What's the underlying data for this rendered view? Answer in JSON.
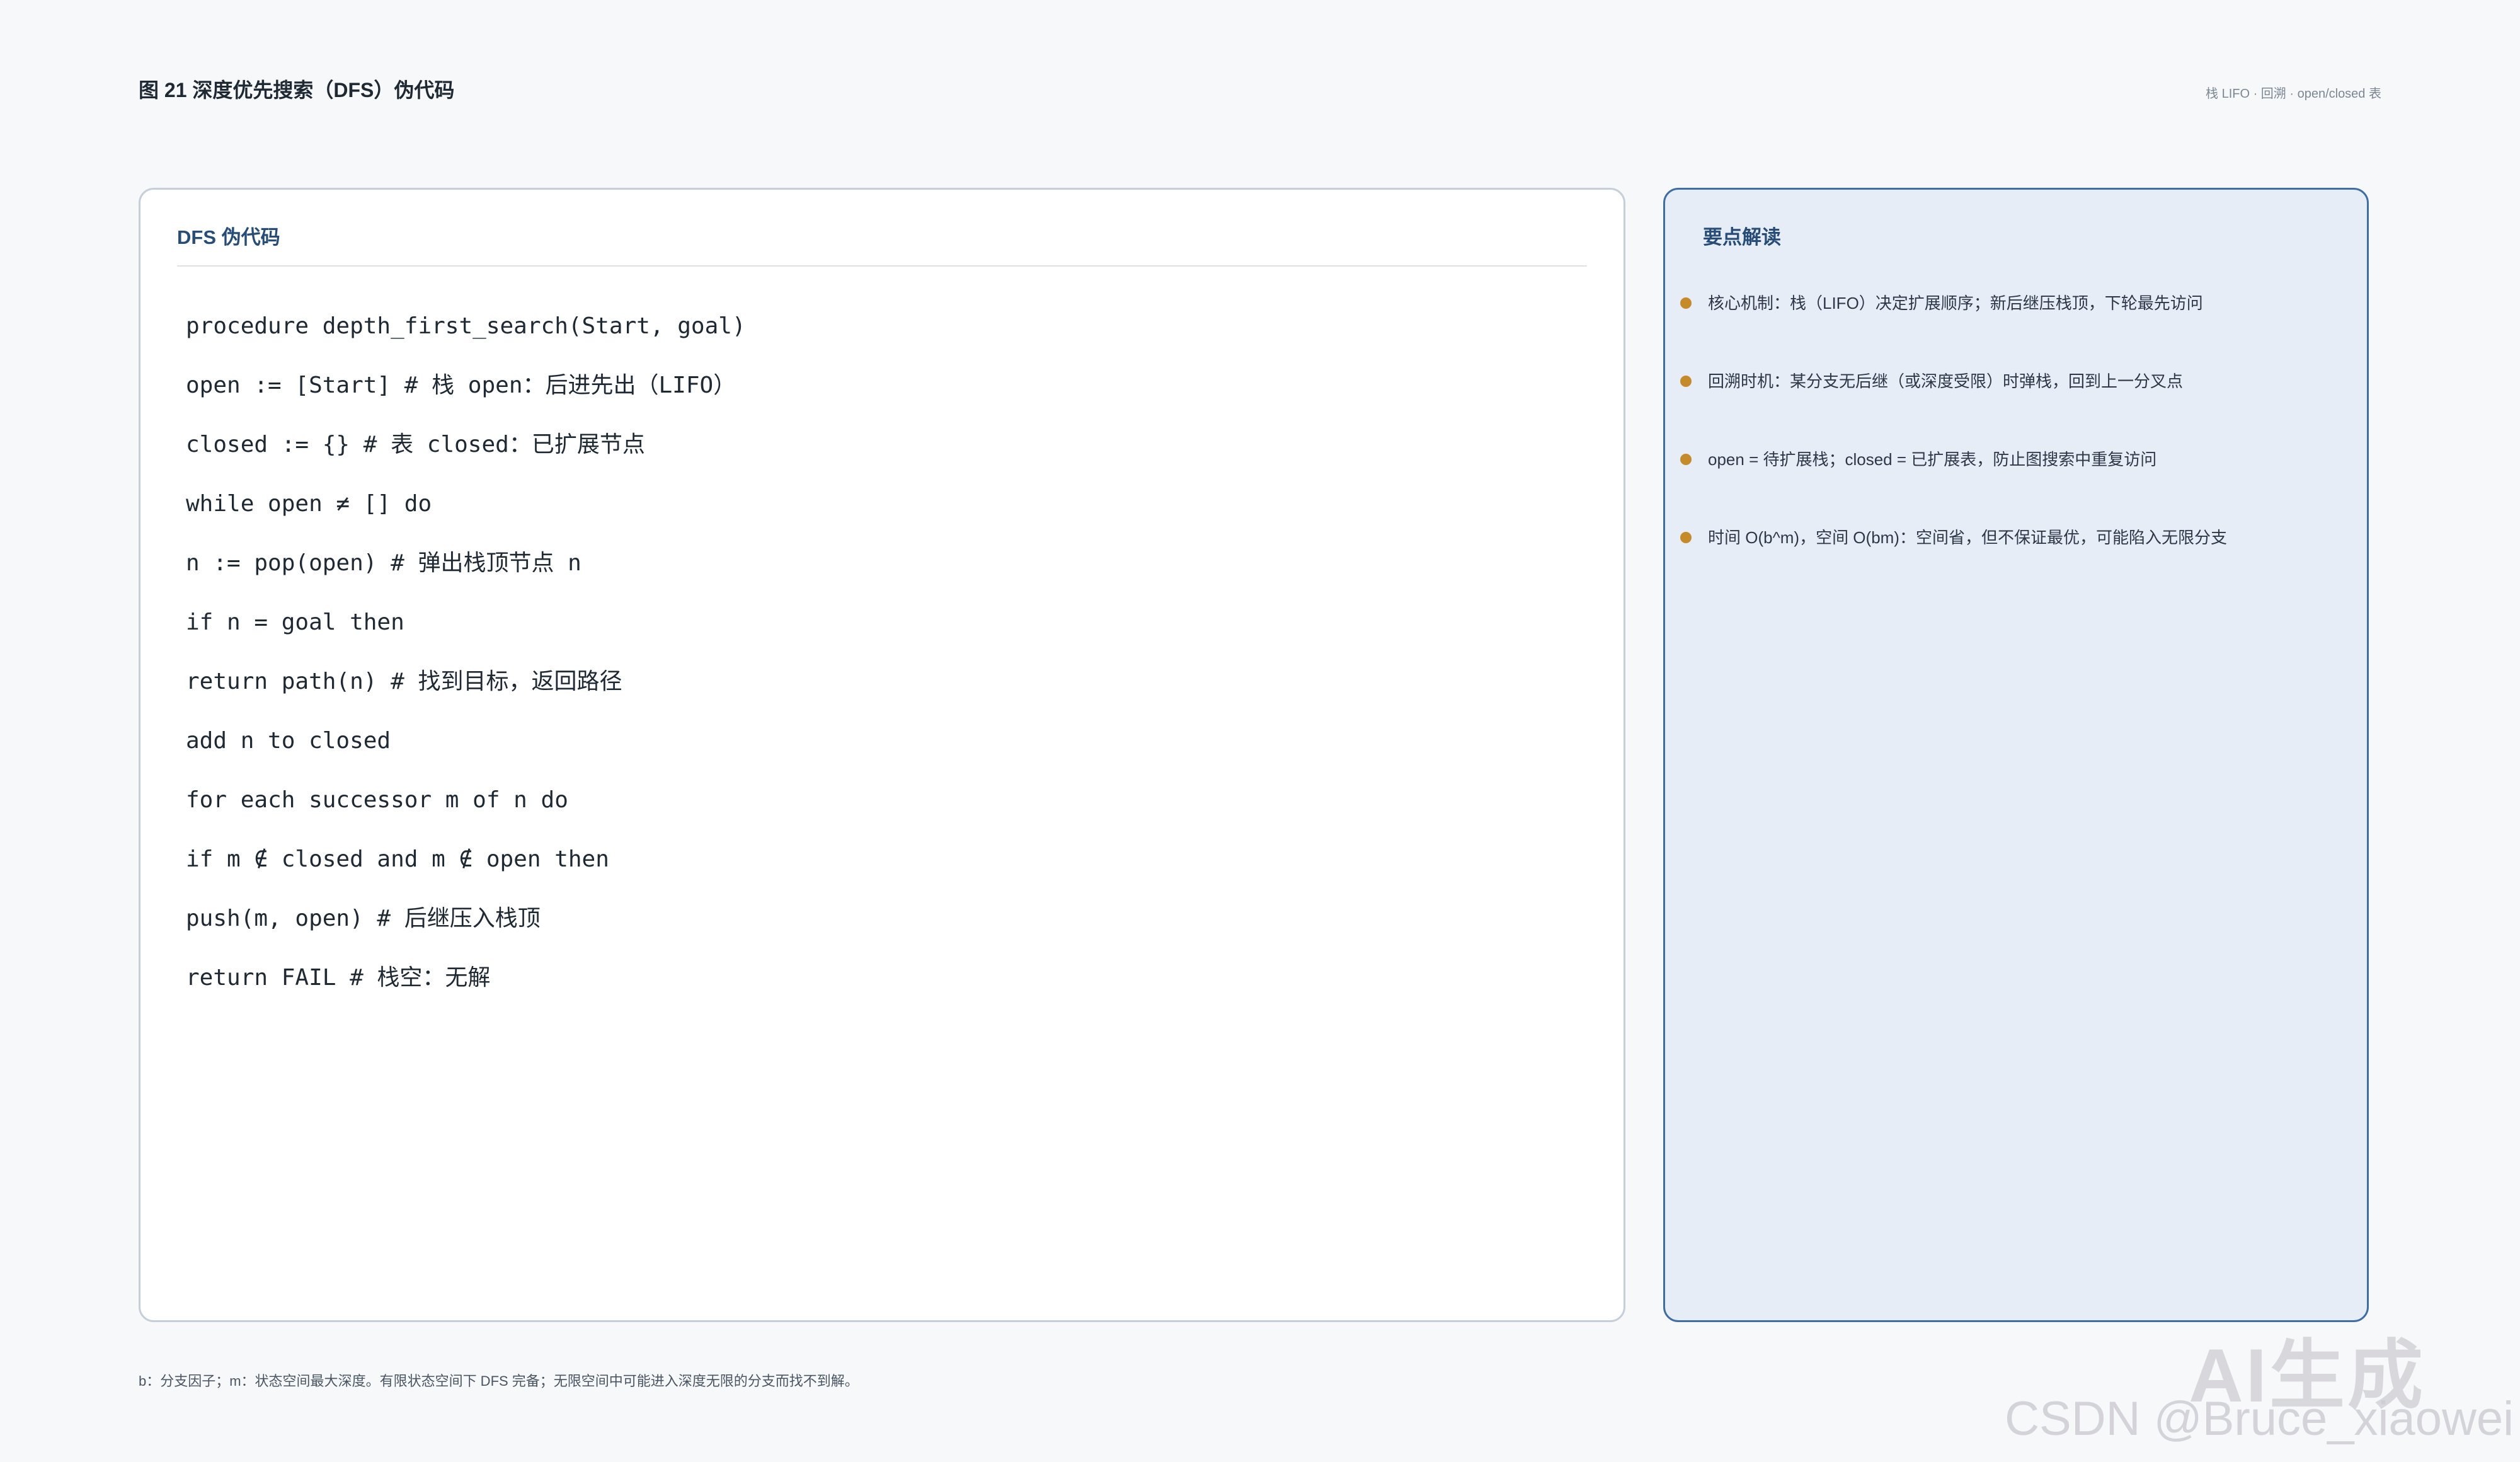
{
  "figure": {
    "title": "图 21 深度优先搜索（DFS）伪代码",
    "tags": "栈 LIFO · 回溯 · open/closed 表"
  },
  "code_panel": {
    "title": "DFS 伪代码",
    "lines": [
      "procedure depth_first_search(Start, goal)",
      "open := [Start] # 栈 open：后进先出（LIFO）",
      "closed := {} # 表 closed：已扩展节点",
      "while open ≠ [] do",
      "n := pop(open) # 弹出栈顶节点 n",
      "if n = goal then",
      "return path(n) # 找到目标，返回路径",
      "add n to closed",
      "for each successor m of n do",
      "if m ∉ closed and m ∉ open then",
      "push(m, open) # 后继压入栈顶",
      "return FAIL # 栈空：无解"
    ]
  },
  "notes_panel": {
    "title": "要点解读",
    "bullet_color": "#c58b2b",
    "items": [
      "核心机制：栈（LIFO）决定扩展顺序；新后继压栈顶，下轮最先访问",
      "回溯时机：某分支无后继（或深度受限）时弹栈，回到上一分叉点",
      "open = 待扩展栈；closed = 已扩展表，防止图搜索中重复访问",
      "时间 O(b^m)，空间 O(bm)：空间省，但不保证最优，可能陷入无限分支"
    ]
  },
  "footnote": "b：分支因子；m：状态空间最大深度。有限状态空间下 DFS 完备；无限空间中可能进入深度无限的分支而找不到解。",
  "watermark": {
    "logo": "AI生成",
    "credit": "CSDN @Bruce_xiaowei"
  },
  "colors": {
    "accent": "#274c77",
    "notes_border": "#3e6ea3",
    "notes_bg": "#e6edf6"
  }
}
